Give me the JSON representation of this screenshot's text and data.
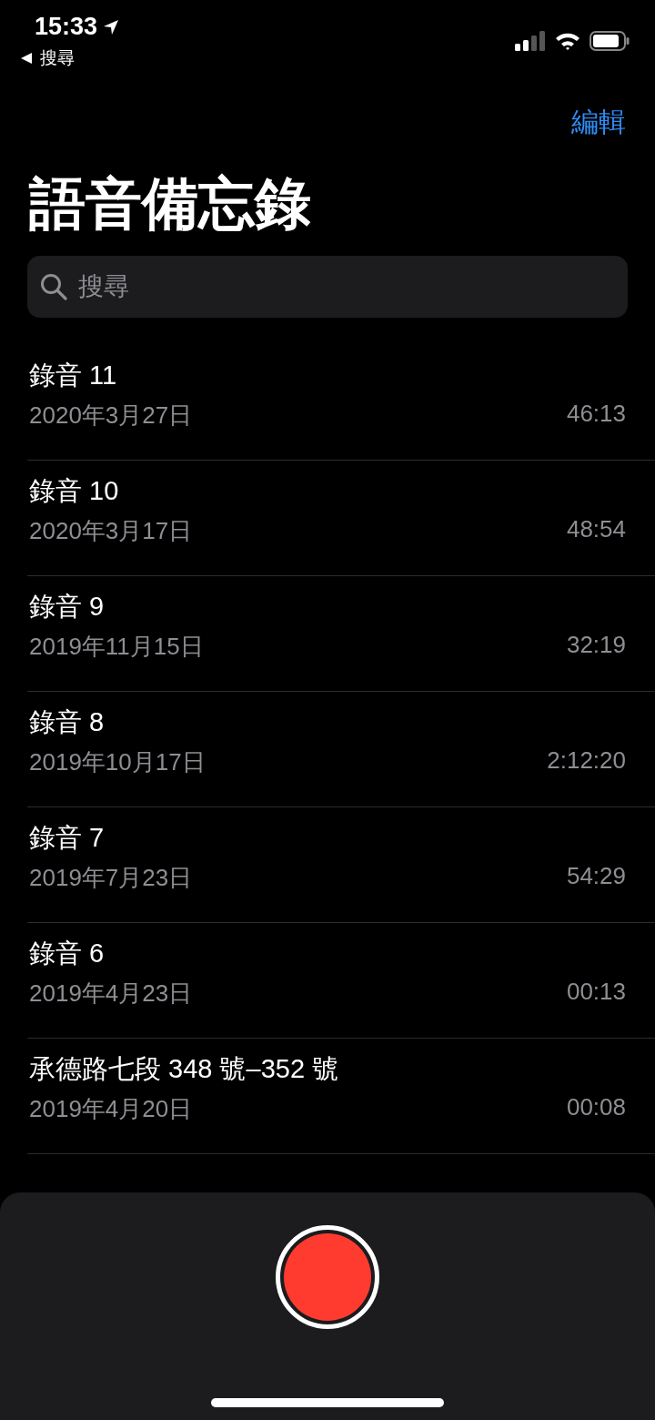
{
  "status_bar": {
    "time": "15:33",
    "back_label": "搜尋"
  },
  "nav": {
    "edit": "編輯"
  },
  "title": "語音備忘錄",
  "search": {
    "placeholder": "搜尋"
  },
  "recordings": [
    {
      "name": "錄音 11",
      "date": "2020年3月27日",
      "duration": "46:13"
    },
    {
      "name": "錄音 10",
      "date": "2020年3月17日",
      "duration": "48:54"
    },
    {
      "name": "錄音 9",
      "date": "2019年11月15日",
      "duration": "32:19"
    },
    {
      "name": "錄音 8",
      "date": "2019年10月17日",
      "duration": "2:12:20"
    },
    {
      "name": "錄音 7",
      "date": "2019年7月23日",
      "duration": "54:29"
    },
    {
      "name": "錄音 6",
      "date": "2019年4月23日",
      "duration": "00:13"
    },
    {
      "name": "承德路七段 348 號–352 號",
      "date": "2019年4月20日",
      "duration": "00:08"
    }
  ]
}
